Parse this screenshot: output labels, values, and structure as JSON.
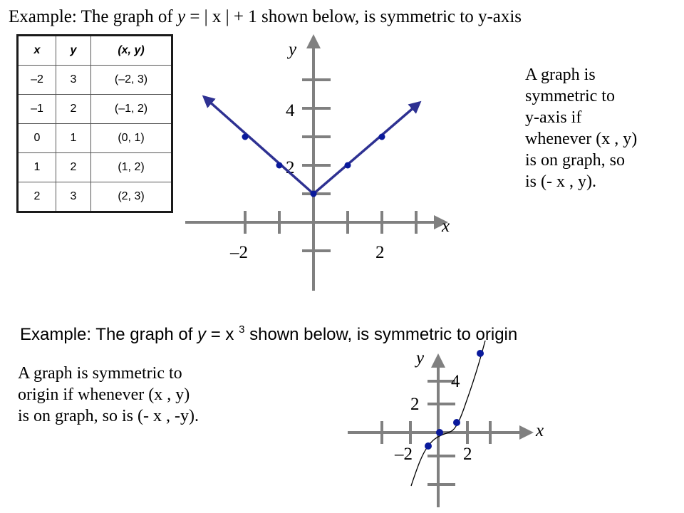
{
  "slide": {
    "example1": {
      "prefix": "Example: The graph of ",
      "y_var": "y",
      "equation_rest": " = | x | + 1  shown below, is symmetric to y-axis"
    },
    "table": {
      "headers": [
        "x",
        "y",
        "(x, y)"
      ],
      "rows": [
        [
          "–2",
          "3",
          "(–2, 3)"
        ],
        [
          "–1",
          "2",
          "(–1, 2)"
        ],
        [
          "0",
          "1",
          "(0, 1)"
        ],
        [
          "1",
          "2",
          "(1, 2)"
        ],
        [
          "2",
          "3",
          "(2, 3)"
        ]
      ]
    },
    "note1_lines": [
      "A graph is",
      "symmetric  to",
      "y-axis if",
      "whenever  (x , y)",
      "is on graph, so",
      "is (- x , y)."
    ],
    "example2": {
      "prefix": "Example:  The graph of ",
      "y_var": "y",
      "equation_mid": " = x ",
      "exponent": "3",
      "suffix": " shown below,  is symmetric to origin"
    },
    "note2_lines": [
      "A graph is symmetric  to",
      "origin if whenever  (x , y)",
      "is on graph, so is (- x , -y)."
    ]
  },
  "colors": {
    "axis": "#808080",
    "curve1": "#2e3192",
    "curve2": "#000000",
    "points": "#0a1a9c"
  },
  "chart_data": [
    {
      "type": "line",
      "title": "y = |x| + 1",
      "xlabel": "x",
      "ylabel": "y",
      "x_tick_labels": [
        "–2",
        "2"
      ],
      "y_tick_labels": [
        "2",
        "4"
      ],
      "xlim": [
        -3,
        3
      ],
      "ylim": [
        -1,
        5
      ],
      "series": [
        {
          "name": "y = |x| + 1",
          "points": [
            [
              -2,
              3
            ],
            [
              -1,
              2
            ],
            [
              0,
              1
            ],
            [
              1,
              2
            ],
            [
              2,
              3
            ]
          ],
          "ray_ends": [
            [
              -3.2,
              4.4
            ],
            [
              3.1,
              4.2
            ]
          ]
        }
      ],
      "grid": false
    },
    {
      "type": "line",
      "title": "y = x^3",
      "xlabel": "x",
      "ylabel": "y",
      "x_tick_labels": [
        "–2",
        "2"
      ],
      "y_tick_labels": [
        "2",
        "4"
      ],
      "series": [
        {
          "name": "y = x^3",
          "points": [
            [
              -1,
              -1
            ],
            [
              0,
              0
            ],
            [
              1,
              1
            ],
            [
              2,
              8
            ]
          ]
        }
      ],
      "grid": false
    }
  ]
}
